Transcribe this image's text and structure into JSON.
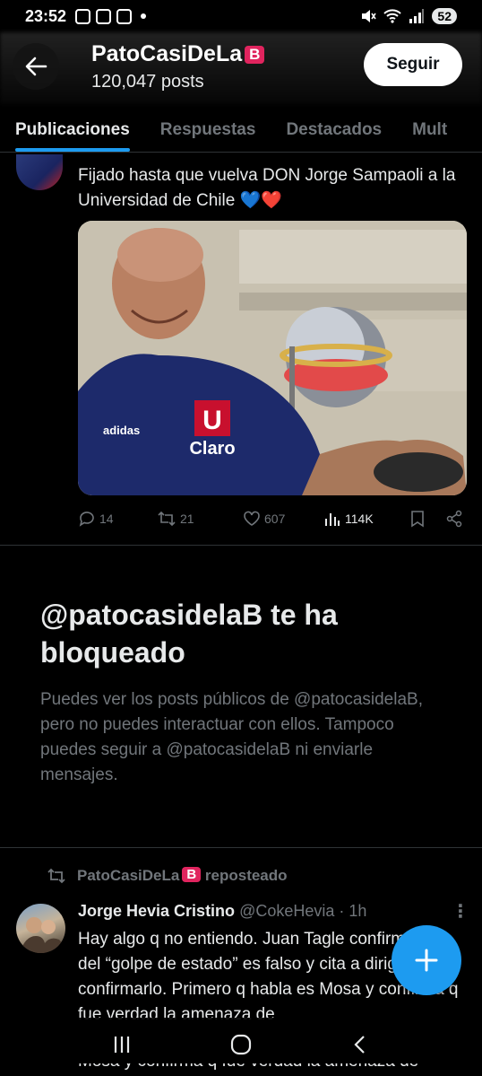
{
  "status_bar": {
    "time": "23:52",
    "battery": "52"
  },
  "header": {
    "title": "PatoCasiDeLa",
    "title_badge": "B",
    "post_count": "120,047 posts",
    "follow_label": "Seguir"
  },
  "tabs": [
    {
      "label": "Publicaciones",
      "active": true
    },
    {
      "label": "Respuestas",
      "active": false
    },
    {
      "label": "Destacados",
      "active": false
    },
    {
      "label": "Mult",
      "active": false
    }
  ],
  "tweet1": {
    "text": "Fijado hasta que vuelva DON Jorge Sampaoli a la Universidad de Chile ",
    "emoji_hearts": [
      "💙",
      "❤️"
    ],
    "image_text": {
      "sponsor": "adidas",
      "crest": "U",
      "brand": "Claro"
    },
    "actions": {
      "replies": "14",
      "reposts": "21",
      "likes": "607",
      "views": "114K"
    }
  },
  "blocked": {
    "title": "@patocasidelaB te ha bloqueado",
    "body": "Puedes ver los posts públicos de @patocasidelaB, pero no puedes interactuar con ellos. Tampoco puedes seguir a @patocasidelaB ni enviarle mensajes."
  },
  "tweet2": {
    "repost_name": "PatoCasiDeLa",
    "repost_badge": "B",
    "repost_suffix": " reposteado",
    "name": "Jorge Hevia Cristino",
    "handle": "@CokeHevia",
    "time": "· 1h",
    "text": "Hay algo q no entiendo. Juan Tagle confirma q lo del “golpe de estado” es falso y cita a dirigentes a confirmarlo. Primero q habla es Mosa y confirma q fue verdad la amenaza de",
    "next_line": "Mosa y confirma q fue verdad la amenaza de"
  },
  "colors": {
    "accent": "#1d9bf0",
    "background": "#000000",
    "muted": "#71767b",
    "badge": "#e0245e"
  }
}
